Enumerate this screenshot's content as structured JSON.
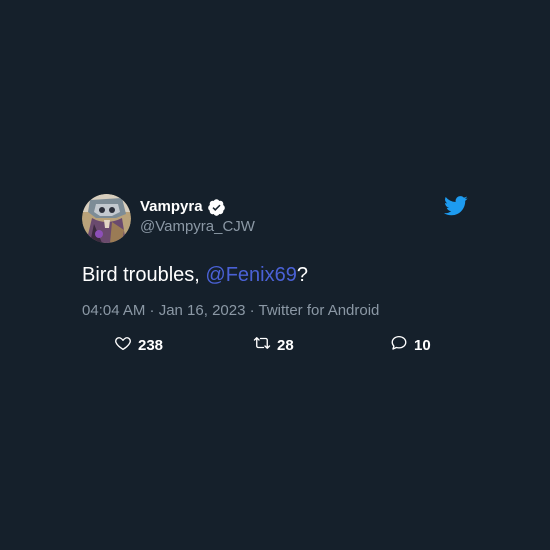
{
  "user": {
    "display_name": "Vampyra",
    "handle": "@Vampyra_CJW",
    "verified": true
  },
  "tweet": {
    "text_before": "Bird troubles, ",
    "mention": "@Fenix69",
    "text_after": "?",
    "timestamp": "04:04 AM · Jan 16, 2023 · Twitter for Android"
  },
  "actions": {
    "likes": "238",
    "retweets": "28",
    "replies": "10"
  },
  "icons": {
    "verified": "verified-badge-icon",
    "brand": "twitter-bird-icon",
    "like": "heart-icon",
    "retweet": "retweet-icon",
    "reply": "reply-bubble-icon"
  },
  "colors": {
    "background": "#15202b",
    "mention": "#4a61d6",
    "muted": "#8b98a5",
    "brand": "#1d9bf0"
  }
}
